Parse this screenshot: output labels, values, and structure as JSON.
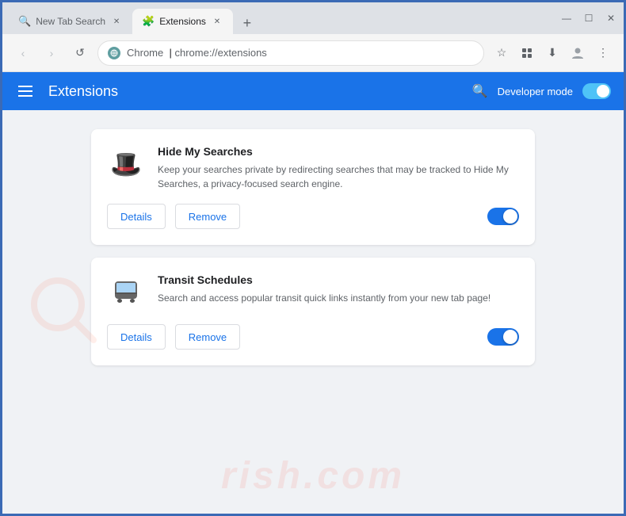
{
  "browser": {
    "tabs": [
      {
        "id": "tab-search",
        "label": "New Tab Search",
        "icon": "🔍",
        "active": false
      },
      {
        "id": "extensions",
        "label": "Extensions",
        "icon": "🧩",
        "active": true
      }
    ],
    "new_tab_label": "+",
    "window_controls": {
      "minimize": "—",
      "maximize": "☐",
      "close": "✕"
    },
    "address_bar": {
      "back_btn": "‹",
      "forward_btn": "›",
      "refresh_btn": "↺",
      "site_name": "Chrome",
      "url": "chrome://extensions",
      "separator": "|",
      "bookmark_icon": "☆",
      "profile_icon": "👤",
      "menu_icon": "⋮"
    }
  },
  "header": {
    "hamburger_label": "menu",
    "title": "Extensions",
    "search_label": "search",
    "developer_mode_label": "Developer mode"
  },
  "extensions": [
    {
      "id": "hide-my-searches",
      "name": "Hide My Searches",
      "description": "Keep your searches private by redirecting searches that may be tracked to Hide My Searches, a privacy-focused search engine.",
      "icon": "🎩",
      "enabled": true,
      "details_label": "Details",
      "remove_label": "Remove"
    },
    {
      "id": "transit-schedules",
      "name": "Transit Schedules",
      "description": "Search and access popular transit quick links instantly from your new tab page!",
      "icon": "🚌",
      "enabled": true,
      "details_label": "Details",
      "remove_label": "Remove"
    }
  ],
  "watermark": {
    "text": "rish.com"
  }
}
